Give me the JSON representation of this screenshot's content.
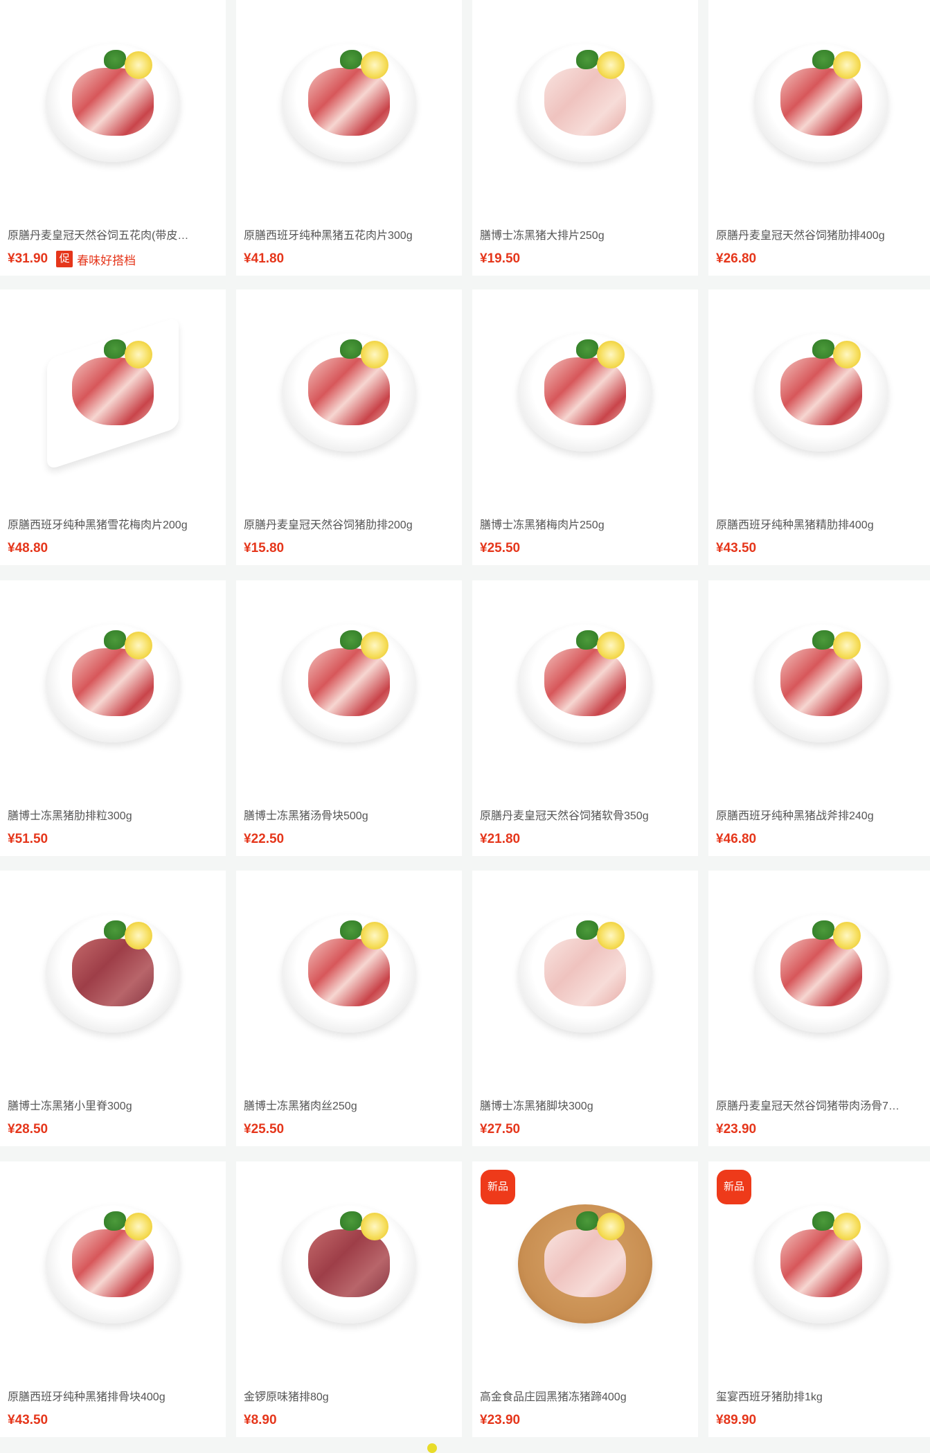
{
  "products": [
    {
      "title": "原膳丹麦皇冠天然谷饲五花肉(带皮…",
      "price": "¥31.90",
      "promo_tag": "促",
      "promo_text": "春味好搭档",
      "badge": "",
      "style": "plate"
    },
    {
      "title": "原膳西班牙纯种黑猪五花肉片300g",
      "price": "¥41.80",
      "badge": "",
      "style": "plate"
    },
    {
      "title": "膳博士冻黑猪大排片250g",
      "price": "¥19.50",
      "badge": "",
      "style": "plate-pale"
    },
    {
      "title": "原膳丹麦皇冠天然谷饲猪肋排400g",
      "price": "¥26.80",
      "badge": "",
      "style": "plate"
    },
    {
      "title": "原膳西班牙纯种黑猪雪花梅肉片200g",
      "price": "¥48.80",
      "badge": "",
      "style": "tray"
    },
    {
      "title": "原膳丹麦皇冠天然谷饲猪肋排200g",
      "price": "¥15.80",
      "badge": "",
      "style": "plate"
    },
    {
      "title": "膳博士冻黑猪梅肉片250g",
      "price": "¥25.50",
      "badge": "",
      "style": "plate"
    },
    {
      "title": "原膳西班牙纯种黑猪精肋排400g",
      "price": "¥43.50",
      "badge": "",
      "style": "plate"
    },
    {
      "title": "膳博士冻黑猪肋排粒300g",
      "price": "¥51.50",
      "badge": "",
      "style": "plate"
    },
    {
      "title": "膳博士冻黑猪汤骨块500g",
      "price": "¥22.50",
      "badge": "",
      "style": "plate"
    },
    {
      "title": "原膳丹麦皇冠天然谷饲猪软骨350g",
      "price": "¥21.80",
      "badge": "",
      "style": "plate"
    },
    {
      "title": "原膳西班牙纯种黑猪战斧排240g",
      "price": "¥46.80",
      "badge": "",
      "style": "plate"
    },
    {
      "title": "膳博士冻黑猪小里脊300g",
      "price": "¥28.50",
      "badge": "",
      "style": "plate-dark"
    },
    {
      "title": "膳博士冻黑猪肉丝250g",
      "price": "¥25.50",
      "badge": "",
      "style": "plate"
    },
    {
      "title": "膳博士冻黑猪脚块300g",
      "price": "¥27.50",
      "badge": "",
      "style": "plate-pale"
    },
    {
      "title": "原膳丹麦皇冠天然谷饲猪带肉汤骨7…",
      "price": "¥23.90",
      "badge": "",
      "style": "plate"
    },
    {
      "title": "原膳西班牙纯种黑猪排骨块400g",
      "price": "¥43.50",
      "badge": "",
      "style": "plate"
    },
    {
      "title": "金锣原味猪排80g",
      "price": "¥8.90",
      "badge": "",
      "style": "plate-dark"
    },
    {
      "title": "高金食品庄园黑猪冻猪蹄400g",
      "price": "¥23.90",
      "badge": "新品",
      "style": "board"
    },
    {
      "title": "玺宴西班牙猪肋排1kg",
      "price": "¥89.90",
      "badge": "新品",
      "style": "plate"
    }
  ],
  "colors": {
    "price": "#e5361b",
    "badge_bg": "#ee3a1a",
    "background": "#f4f6f5"
  }
}
